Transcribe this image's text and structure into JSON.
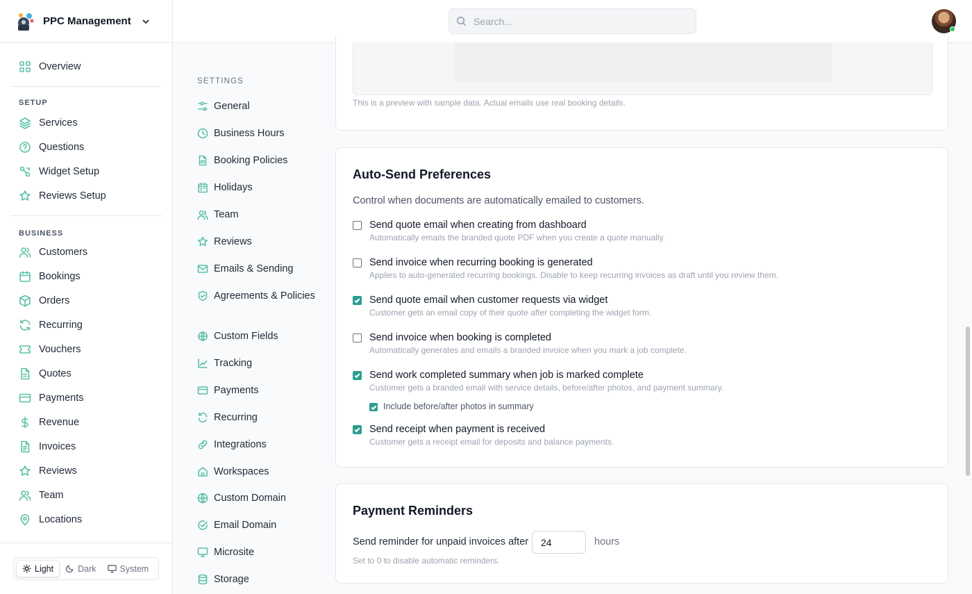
{
  "brand": {
    "name": "PPC Management"
  },
  "search": {
    "placeholder": "Search..."
  },
  "sidebar": {
    "overview": {
      "label": "Overview",
      "icon": "grid-icon"
    },
    "setup_title": "SETUP",
    "setup": [
      {
        "label": "Services",
        "icon": "layers-icon"
      },
      {
        "label": "Questions",
        "icon": "help-circle-icon"
      },
      {
        "label": "Widget Setup",
        "icon": "widget-icon"
      },
      {
        "label": "Reviews Setup",
        "icon": "star-icon"
      }
    ],
    "business_title": "BUSINESS",
    "business": [
      {
        "label": "Customers",
        "icon": "users-icon"
      },
      {
        "label": "Bookings",
        "icon": "calendar-icon"
      },
      {
        "label": "Orders",
        "icon": "box-icon"
      },
      {
        "label": "Recurring",
        "icon": "refresh-icon"
      },
      {
        "label": "Vouchers",
        "icon": "ticket-icon"
      },
      {
        "label": "Quotes",
        "icon": "file-icon"
      },
      {
        "label": "Payments",
        "icon": "credit-card-icon"
      },
      {
        "label": "Revenue",
        "icon": "dollar-icon"
      },
      {
        "label": "Invoices",
        "icon": "invoice-icon"
      },
      {
        "label": "Reviews",
        "icon": "star-icon"
      },
      {
        "label": "Team",
        "icon": "users-icon"
      },
      {
        "label": "Locations",
        "icon": "map-pin-icon"
      }
    ],
    "theme": {
      "light": "Light",
      "dark": "Dark",
      "system": "System"
    }
  },
  "settings_nav": {
    "title": "SETTINGS",
    "items": [
      {
        "label": "General",
        "icon": "sliders-icon"
      },
      {
        "label": "Business Hours",
        "icon": "clock-icon"
      },
      {
        "label": "Booking Policies",
        "icon": "file-icon"
      },
      {
        "label": "Holidays",
        "icon": "calendar-icon"
      },
      {
        "label": "Team",
        "icon": "users-icon"
      },
      {
        "label": "Reviews",
        "icon": "star-icon"
      },
      {
        "label": "Emails & Sending",
        "icon": "mail-icon"
      },
      {
        "label": "Agreements & Policies",
        "icon": "shield-check-icon"
      },
      {
        "label": "Custom Fields",
        "icon": "fields-icon"
      },
      {
        "label": "Tracking",
        "icon": "chart-line-icon"
      },
      {
        "label": "Payments",
        "icon": "credit-card-icon"
      },
      {
        "label": "Recurring",
        "icon": "refresh-icon"
      },
      {
        "label": "Integrations",
        "icon": "link-icon"
      },
      {
        "label": "Workspaces",
        "icon": "home-icon"
      },
      {
        "label": "Custom Domain",
        "icon": "globe-icon"
      },
      {
        "label": "Email Domain",
        "icon": "check-badge-icon"
      },
      {
        "label": "Microsite",
        "icon": "monitor-icon"
      },
      {
        "label": "Storage",
        "icon": "database-icon"
      }
    ]
  },
  "preview": {
    "note": "This is a preview with sample data. Actual emails use real booking details."
  },
  "auto_send": {
    "title": "Auto-Send Preferences",
    "description": "Control when documents are automatically emailed to customers.",
    "options": [
      {
        "label": "Send quote email when creating from dashboard",
        "help": "Automatically emails the branded quote PDF when you create a quote manually.",
        "checked": false
      },
      {
        "label": "Send invoice when recurring booking is generated",
        "help": "Applies to auto-generated recurring bookings. Disable to keep recurring invoices as draft until you review them.",
        "checked": false
      },
      {
        "label": "Send quote email when customer requests via widget",
        "help": "Customer gets an email copy of their quote after completing the widget form.",
        "checked": true
      },
      {
        "label": "Send invoice when booking is completed",
        "help": "Automatically generates and emails a branded invoice when you mark a job complete.",
        "checked": false
      },
      {
        "label": "Send work completed summary when job is marked complete",
        "help": "Customer gets a branded email with service details, before/after photos, and payment summary.",
        "checked": true
      },
      {
        "label": "Send receipt when payment is received",
        "help": "Customer gets a receipt email for deposits and balance payments.",
        "checked": true
      }
    ],
    "sub_option": {
      "label": "Include before/after photos in summary",
      "checked": true
    }
  },
  "reminders": {
    "title": "Payment Reminders",
    "label": "Send reminder for unpaid invoices after",
    "value": "24",
    "unit": "hours",
    "help": "Set to 0 to disable automatic reminders."
  },
  "colors": {
    "accent": "#5cc0a6",
    "checkbox": "#2a9d8f"
  }
}
